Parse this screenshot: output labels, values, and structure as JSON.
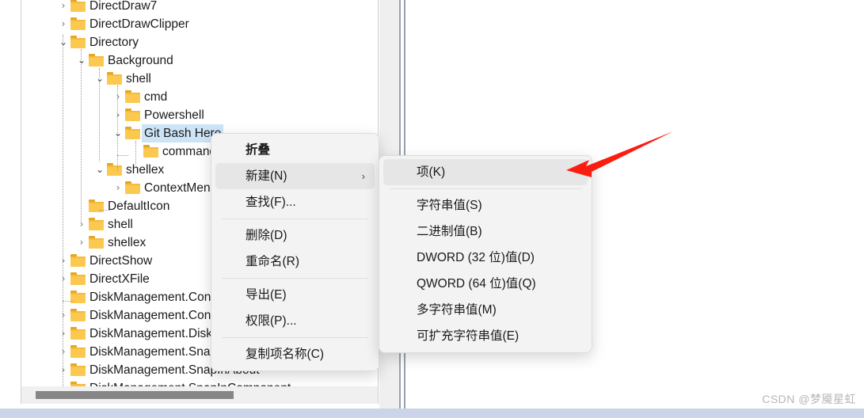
{
  "window": {
    "watermark": "CSDN @梦魇星虹"
  },
  "tree": {
    "rows": [
      {
        "label": "DirectDraw7",
        "depth": 0,
        "state": "collapsed",
        "selected": false
      },
      {
        "label": "DirectDrawClipper",
        "depth": 0,
        "state": "collapsed",
        "selected": false
      },
      {
        "label": "Directory",
        "depth": 0,
        "state": "expanded",
        "selected": false
      },
      {
        "label": "Background",
        "depth": 1,
        "state": "expanded",
        "selected": false
      },
      {
        "label": "shell",
        "depth": 2,
        "state": "expanded",
        "selected": false
      },
      {
        "label": "cmd",
        "depth": 3,
        "state": "collapsed",
        "selected": false
      },
      {
        "label": "Powershell",
        "depth": 3,
        "state": "collapsed",
        "selected": false
      },
      {
        "label": "Git Bash Here",
        "depth": 3,
        "state": "expanded",
        "selected": true
      },
      {
        "label": "command",
        "depth": 4,
        "state": "leaf",
        "selected": false
      },
      {
        "label": "shellex",
        "depth": 2,
        "state": "expanded",
        "selected": false
      },
      {
        "label": "ContextMenuHandlers",
        "depth": 3,
        "state": "collapsed",
        "selected": false
      },
      {
        "label": "DefaultIcon",
        "depth": 1,
        "state": "leaf",
        "selected": false
      },
      {
        "label": "shell",
        "depth": 1,
        "state": "collapsed",
        "selected": false
      },
      {
        "label": "shellex",
        "depth": 1,
        "state": "collapsed",
        "selected": false
      },
      {
        "label": "DirectShow",
        "depth": 0,
        "state": "collapsed",
        "selected": false
      },
      {
        "label": "DirectXFile",
        "depth": 0,
        "state": "collapsed",
        "selected": false
      },
      {
        "label": "DiskManagement.Control",
        "depth": 0,
        "state": "leaf",
        "selected": false
      },
      {
        "label": "DiskManagement.Connection",
        "depth": 0,
        "state": "collapsed",
        "selected": false
      },
      {
        "label": "DiskManagement.DiskSystem",
        "depth": 0,
        "state": "collapsed",
        "selected": false
      },
      {
        "label": "DiskManagement.SnapIn",
        "depth": 0,
        "state": "collapsed",
        "selected": false
      },
      {
        "label": "DiskManagement.SnapInAbout",
        "depth": 0,
        "state": "collapsed",
        "selected": false
      },
      {
        "label": "DiskManagement.SnapInComponent",
        "depth": 0,
        "state": "collapsed",
        "selected": false
      }
    ],
    "chevron_collapsed": "›",
    "chevron_expanded": "⌄"
  },
  "context_menu": {
    "items": [
      {
        "label": "折叠",
        "bold": true,
        "highlight": false,
        "submenu": false,
        "separator_after": false
      },
      {
        "label": "新建(N)",
        "bold": false,
        "highlight": true,
        "submenu": true,
        "separator_after": false
      },
      {
        "label": "查找(F)...",
        "bold": false,
        "highlight": false,
        "submenu": false,
        "separator_after": true
      },
      {
        "label": "删除(D)",
        "bold": false,
        "highlight": false,
        "submenu": false,
        "separator_after": false
      },
      {
        "label": "重命名(R)",
        "bold": false,
        "highlight": false,
        "submenu": false,
        "separator_after": true
      },
      {
        "label": "导出(E)",
        "bold": false,
        "highlight": false,
        "submenu": false,
        "separator_after": false
      },
      {
        "label": "权限(P)...",
        "bold": false,
        "highlight": false,
        "submenu": false,
        "separator_after": true
      },
      {
        "label": "复制项名称(C)",
        "bold": false,
        "highlight": false,
        "submenu": false,
        "separator_after": false
      }
    ],
    "submenu_arrow": "›"
  },
  "submenu": {
    "items": [
      {
        "label": "项(K)",
        "highlight": true,
        "separator_after": true
      },
      {
        "label": "字符串值(S)",
        "highlight": false,
        "separator_after": false
      },
      {
        "label": "二进制值(B)",
        "highlight": false,
        "separator_after": false
      },
      {
        "label": "DWORD (32 位)值(D)",
        "highlight": false,
        "separator_after": false
      },
      {
        "label": "QWORD (64 位)值(Q)",
        "highlight": false,
        "separator_after": false
      },
      {
        "label": "多字符串值(M)",
        "highlight": false,
        "separator_after": false
      },
      {
        "label": "可扩充字符串值(E)",
        "highlight": false,
        "separator_after": false
      }
    ]
  },
  "annotation": {
    "arrow_color": "#fb1e10",
    "arrow_label": "red-pointer-arrow"
  },
  "colors": {
    "selection": "#cde4f7",
    "menu_bg": "#f3f3f3",
    "menu_highlight": "#e6e6e6",
    "folder": "#fbc950",
    "bottom_band": "#ccd4ea"
  }
}
